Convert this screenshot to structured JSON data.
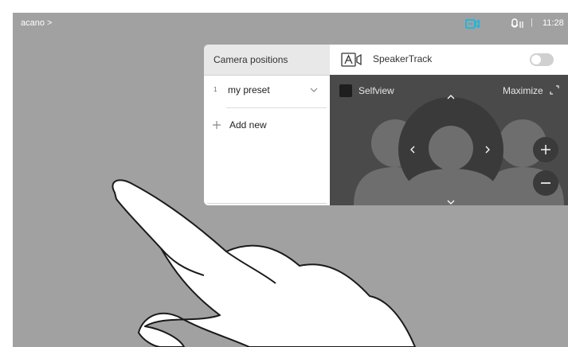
{
  "topbar": {
    "breadcrumb": "acano >",
    "time": "11:28",
    "separator": "|",
    "camera_icon": "camera-icon",
    "mic_icon": "microphone-icon",
    "accent": "#00bceb"
  },
  "camera_panel": {
    "title": "Camera positions",
    "presets": [
      {
        "number": "1",
        "label": "my preset"
      }
    ],
    "add_label": "Add new"
  },
  "speakertrack": {
    "label": "SpeakerTrack",
    "enabled": false
  },
  "selfview": {
    "label": "Selfview",
    "maximize_label": "Maximize"
  },
  "controls": {
    "pan_tilt": [
      "up",
      "down",
      "left",
      "right"
    ],
    "zoom": [
      "zoom-in",
      "zoom-out"
    ]
  }
}
